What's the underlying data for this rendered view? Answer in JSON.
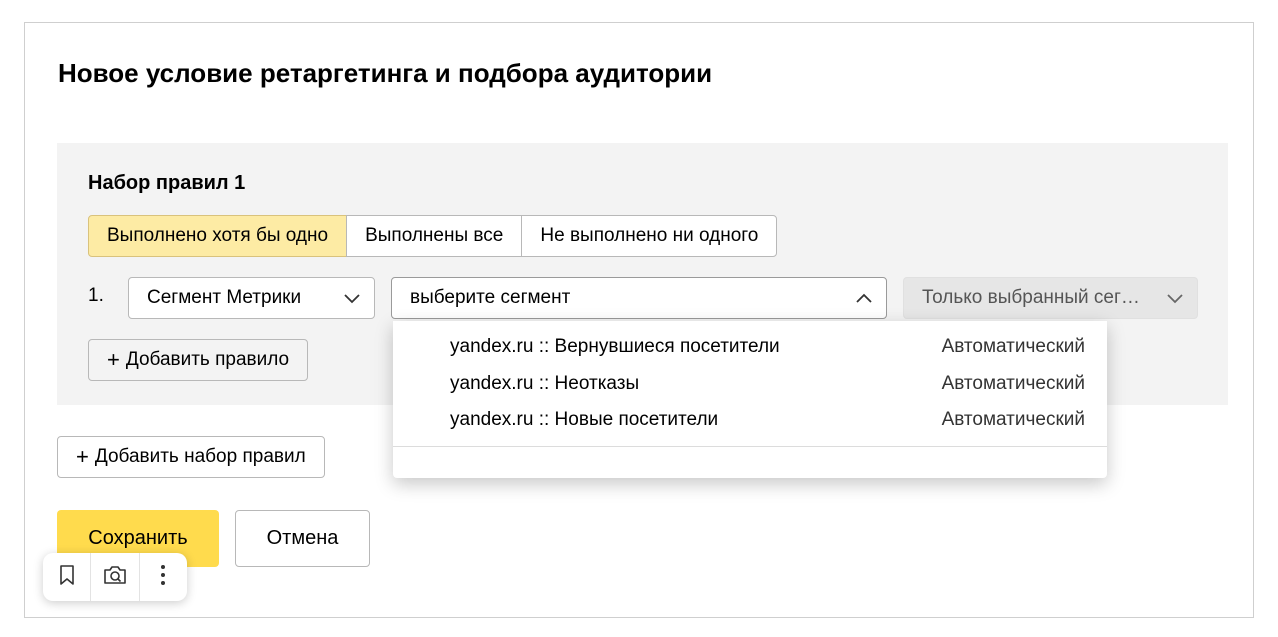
{
  "dialog": {
    "title": "Новое условие ретаргетинга и подбора аудитории"
  },
  "ruleset": {
    "title": "Набор правил 1",
    "mode_options": [
      {
        "label": "Выполнено хотя бы одно",
        "selected": true
      },
      {
        "label": "Выполнены все",
        "selected": false
      },
      {
        "label": "Не выполнено ни одного",
        "selected": false
      }
    ],
    "rule": {
      "number": "1.",
      "type_select": "Сегмент Метрики",
      "segment_select_placeholder": "выберите сегмент",
      "scope_select": "Только выбранный сег…"
    },
    "add_rule_label": "Добавить правило"
  },
  "dropdown": {
    "options": [
      {
        "name": "yandex.ru :: Вернувшиеся посетители",
        "kind": "Автоматический"
      },
      {
        "name": "yandex.ru :: Неотказы",
        "kind": "Автоматический"
      },
      {
        "name": "yandex.ru :: Новые посетители",
        "kind": "Автоматический"
      }
    ]
  },
  "actions": {
    "add_ruleset_label": "Добавить набор правил",
    "save_label": "Сохранить",
    "cancel_label": "Отмена"
  },
  "toolbar": {
    "icons": [
      "bookmark-icon",
      "camera-search-icon",
      "more-vertical-icon"
    ]
  },
  "colors": {
    "accent": "#ffdb4d",
    "selected_segment": "#fdeba4",
    "panel_bg": "#f3f3f3"
  }
}
